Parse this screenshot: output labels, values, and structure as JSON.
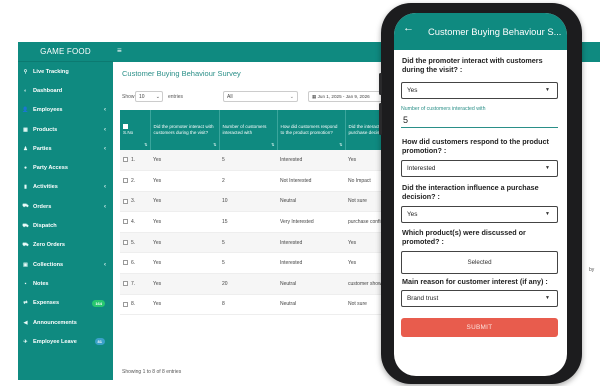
{
  "desktop": {
    "brand": "GAME FOOD",
    "menu_icon": "≡",
    "sidebar": [
      {
        "label": "Live Tracking",
        "icon": "map-pin-icon",
        "glyph": "⚲",
        "chevron": false
      },
      {
        "label": "Dashboard",
        "icon": "dashboard-icon",
        "glyph": "◐",
        "chevron": false
      },
      {
        "label": "Employees",
        "icon": "users-icon",
        "glyph": "👤",
        "chevron": true
      },
      {
        "label": "Products",
        "icon": "products-icon",
        "glyph": "▦",
        "chevron": true
      },
      {
        "label": "Parties",
        "icon": "parties-icon",
        "glyph": "♟",
        "chevron": true
      },
      {
        "label": "Party Access",
        "icon": "key-icon",
        "glyph": "●",
        "chevron": false
      },
      {
        "label": "Activities",
        "icon": "activities-icon",
        "glyph": "▮",
        "chevron": true
      },
      {
        "label": "Orders",
        "icon": "cart-icon",
        "glyph": "⛟",
        "chevron": true
      },
      {
        "label": "Dispatch",
        "icon": "truck-icon",
        "glyph": "⛟",
        "chevron": false
      },
      {
        "label": "Zero Orders",
        "icon": "cart-icon",
        "glyph": "⛟",
        "chevron": false
      },
      {
        "label": "Collections",
        "icon": "collections-icon",
        "glyph": "▣",
        "chevron": true
      },
      {
        "label": "Notes",
        "icon": "notes-icon",
        "glyph": "▪",
        "chevron": false
      },
      {
        "label": "Expenses",
        "icon": "expenses-icon",
        "glyph": "⇄",
        "chevron": false,
        "badge": "164"
      },
      {
        "label": "Announcements",
        "icon": "megaphone-icon",
        "glyph": "◀",
        "chevron": false
      },
      {
        "label": "Employee Leave",
        "icon": "leave-icon",
        "glyph": "✈",
        "chevron": false,
        "badge": "81"
      }
    ],
    "page_title": "Customer Buying Behaviour Survey",
    "show_label": "Show",
    "entries_value": "10",
    "entries_label": "entries",
    "filter_value": "All",
    "date_range": "Jun 1, 2025 - Jan 9, 2026",
    "columns": [
      "S.No",
      "Did the promoter interact with customers during the visit?",
      "Number of customers interacted with",
      "How did customers respond to the product promotion?",
      "Did the interaction influence a purchase decision?"
    ],
    "rows": [
      {
        "sno": "1.",
        "interact": "Yes",
        "count": "5",
        "response": "Interested",
        "influence": "Yes"
      },
      {
        "sno": "2.",
        "interact": "Yes",
        "count": "2",
        "response": "Not Interested",
        "influence": "No Impact"
      },
      {
        "sno": "3.",
        "interact": "Yes",
        "count": "10",
        "response": "Neutral",
        "influence": "Not sure"
      },
      {
        "sno": "4.",
        "interact": "Yes",
        "count": "15",
        "response": "Very Interested",
        "influence": "purchase confirm"
      },
      {
        "sno": "5.",
        "interact": "Yes",
        "count": "5",
        "response": "Interested",
        "influence": "Yes"
      },
      {
        "sno": "6.",
        "interact": "Yes",
        "count": "5",
        "response": "Interested",
        "influence": "Yes"
      },
      {
        "sno": "7.",
        "interact": "Yes",
        "count": "20",
        "response": "Neutral",
        "influence": "customer showed intent"
      },
      {
        "sno": "8.",
        "interact": "Yes",
        "count": "8",
        "response": "Neutral",
        "influence": "Not sure"
      }
    ],
    "footer": "Showing 1 to 8 of 8 entries",
    "peek_text": "by"
  },
  "mobile": {
    "title": "Customer Buying Behaviour S...",
    "q1": "Did the promoter interact with customers during the visit? :",
    "q1_value": "Yes",
    "num_label": "Number of customers interacted with",
    "num_value": "5",
    "q2": "How did customers respond to the product promotion? :",
    "q2_value": "Interested",
    "q3": "Did the interaction influence a purchase decision? :",
    "q3_value": "Yes",
    "q4": "Which product(s) were discussed or promoted? :",
    "q4_value": "Selected",
    "q5": "Main reason for customer interest (if any) :",
    "q5_value": "Brand trust",
    "submit": "SUBMIT"
  },
  "colors": {
    "teal": "#0f8a80",
    "submit": "#e85c4d",
    "badge_green": "#28c76f"
  }
}
